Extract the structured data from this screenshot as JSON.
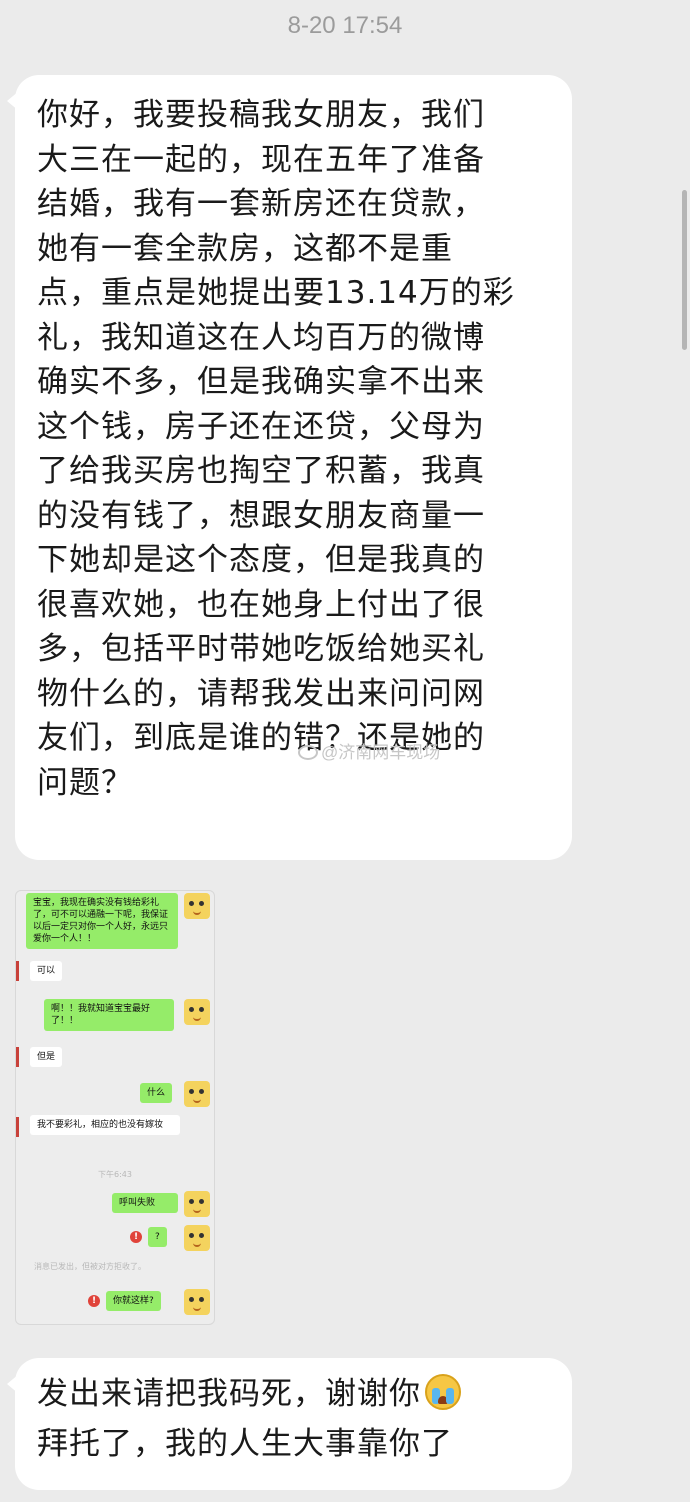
{
  "timestamp": "8-20 17:54",
  "message1": {
    "lines": [
      "你好，我要投稿我女朋友，我们",
      "大三在一起的，现在五年了准备",
      "结婚，我有一套新房还在贷款，",
      "她有一套全款房，这都不是重",
      "点，重点是她提出要13.14万的彩",
      "礼，我知道这在人均百万的微博",
      "确实不多，但是我确实拿不出来",
      "这个钱，房子还在还贷，父母为",
      "了给我买房也掏空了积蓄，我真",
      "的没有钱了，想跟女朋友商量一",
      "下她却是这个态度，但是我真的",
      "很喜欢她，也在她身上付出了很",
      "多，包括平时带她吃饭给她买礼",
      "物什么的，请帮我发出来问问网",
      "友们，到底是谁的错？还是她的",
      "问题？"
    ]
  },
  "watermark": "@济南网车现场",
  "screenshot": {
    "msg_sent_1": "宝宝，我现在确实没有钱给彩礼了，可不可以通融一下呢，我保证以后一定只对你一个人好，永远只爱你一个人！！",
    "msg_recv_1": "可以",
    "msg_sent_2": "啊！！我就知道宝宝最好了！！",
    "msg_recv_2": "但是",
    "msg_sent_3": "什么",
    "msg_recv_3": "我不要彩礼，相应的也没有嫁妆",
    "time_label": "下午6:43",
    "msg_sent_4": "呼叫失败",
    "msg_sent_5": "?",
    "system_note": "消息已发出，但被对方拒收了。",
    "msg_sent_6": "你就这样?"
  },
  "message2": {
    "line1": "发出来请把我码死，谢谢你",
    "line2": "拜托了，我的人生大事靠你了"
  },
  "icons": {
    "emoji": "crying-face-icon",
    "alert": "red-exclamation-icon",
    "avatar": "yellow-cartoon-avatar"
  }
}
